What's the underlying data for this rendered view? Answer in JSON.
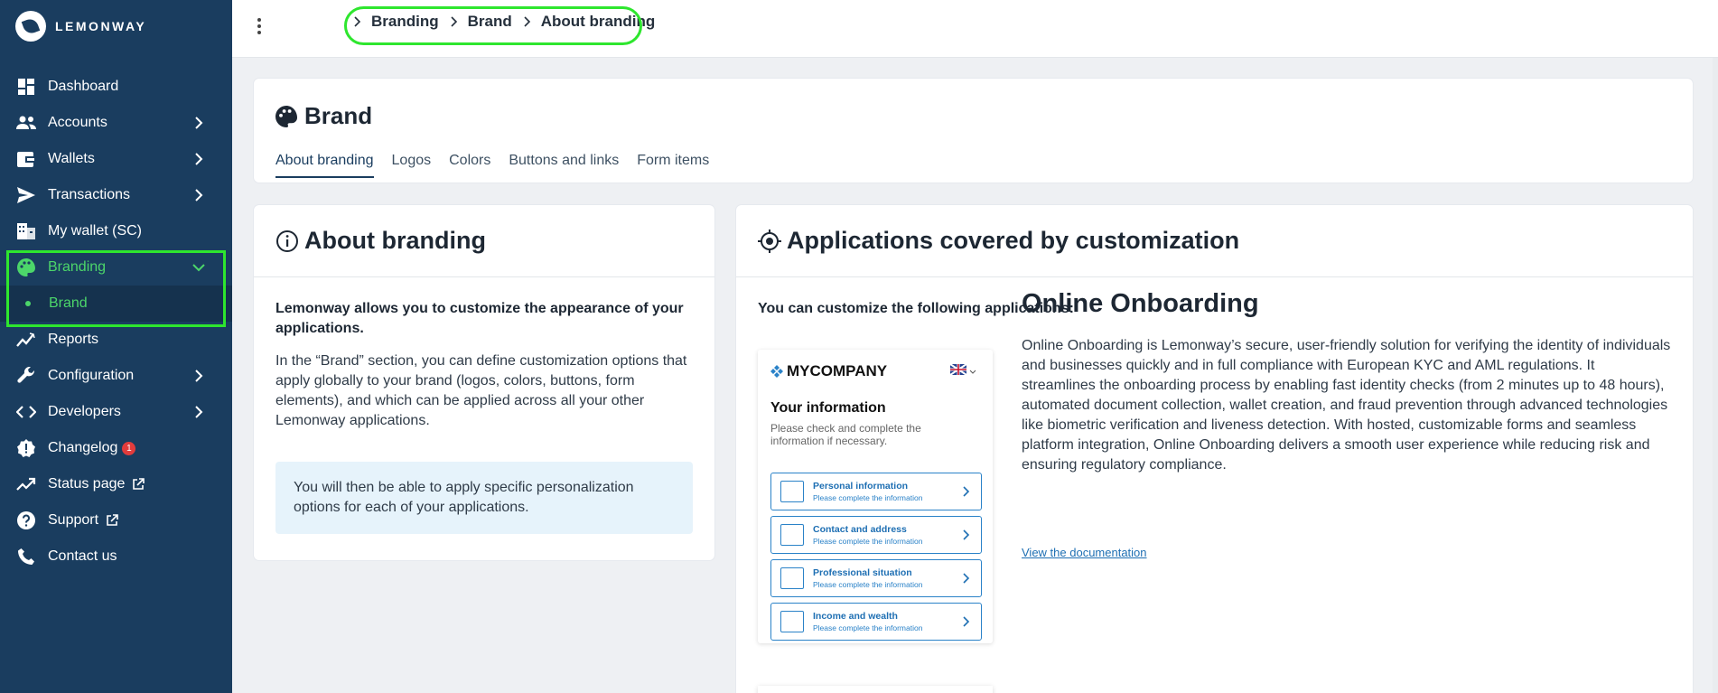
{
  "app": {
    "logo_text": "LEMONWAY"
  },
  "sidebar": {
    "items": [
      {
        "label": "Dashboard"
      },
      {
        "label": "Accounts"
      },
      {
        "label": "Wallets"
      },
      {
        "label": "Transactions"
      },
      {
        "label": "My wallet (SC)"
      },
      {
        "label": "Branding"
      },
      {
        "label": "Brand"
      },
      {
        "label": "Reports"
      },
      {
        "label": "Configuration"
      },
      {
        "label": "Developers"
      },
      {
        "label": "Changelog",
        "badge": "1"
      },
      {
        "label": "Status page"
      },
      {
        "label": "Support"
      },
      {
        "label": "Contact us"
      }
    ]
  },
  "breadcrumb": [
    "Branding",
    "Brand",
    "About branding"
  ],
  "page": {
    "title": "Brand",
    "tabs": [
      "About branding",
      "Logos",
      "Colors",
      "Buttons and links",
      "Form items"
    ]
  },
  "about": {
    "title": "About branding",
    "lead": "Lemonway allows you to customize the appearance of your applications.",
    "body": "In the “Brand” section, you can define customization options that apply globally to your brand (logos, colors, buttons, form elements), and which can be applied across all your other Lemonway applications.",
    "note": "You will then be able to apply specific personalization options for each of your applications."
  },
  "apps": {
    "title": "Applications covered by customization",
    "intro": "You can customize the following applications:",
    "preview": {
      "brand": "MYCOMPANY",
      "title": "Your information",
      "subtitle": "Please check and complete the information if necessary.",
      "rows": [
        {
          "title": "Personal information",
          "sub": "Please complete the information"
        },
        {
          "title": "Contact and address",
          "sub": "Please complete the information"
        },
        {
          "title": "Professional situation",
          "sub": "Please complete the information"
        },
        {
          "title": "Income and wealth",
          "sub": "Please complete the information"
        }
      ]
    },
    "app_title": "Online Onboarding",
    "app_desc": "Online Onboarding is Lemonway’s secure, user-friendly solution for verifying the identity of individuals and businesses quickly and in full compliance with European KYC and AML regulations. It streamlines the onboarding process by enabling fast identity checks (from 2 minutes up to 48 hours), automated document collection, wallet creation, and fraud prevention through advanced technologies like biometric verification and liveness detection. With hosted, customizable forms and seamless platform integration, Online Onboarding delivers a smooth user experience while reducing risk and ensuring regulatory compliance.",
    "doc_link": "View the documentation"
  },
  "colors": {
    "sidebar": "#1a3d5f",
    "accent": "#4cd66a",
    "highlight": "#2ee62e",
    "link": "#1e6fb3"
  }
}
